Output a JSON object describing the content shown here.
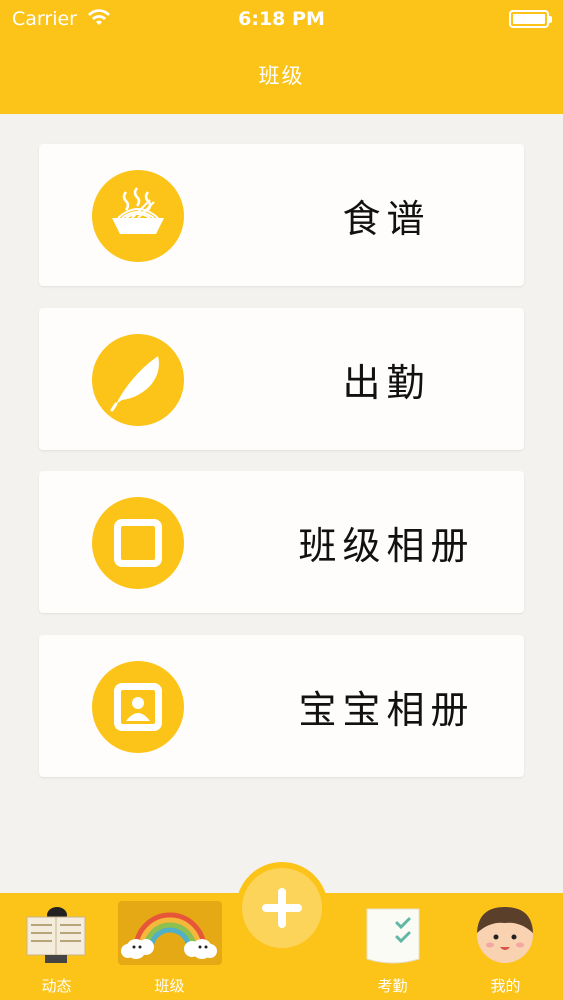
{
  "status_bar": {
    "carrier": "Carrier",
    "time": "6:18 PM"
  },
  "nav": {
    "title": "班级"
  },
  "menu": {
    "items": [
      {
        "label": "食谱",
        "icon": "noodle-bowl-icon"
      },
      {
        "label": "出勤",
        "icon": "feather-icon"
      },
      {
        "label": "班级相册",
        "icon": "photo-frame-icon"
      },
      {
        "label": "宝宝相册",
        "icon": "portrait-frame-icon"
      }
    ]
  },
  "tabbar": {
    "items": [
      {
        "label": "动态",
        "icon": "newspaper-reader-icon",
        "active": false
      },
      {
        "label": "班级",
        "icon": "rainbow-icon",
        "active": true
      },
      {
        "label": "考勤",
        "icon": "checklist-icon",
        "active": false
      },
      {
        "label": "我的",
        "icon": "boy-face-icon",
        "active": false
      }
    ],
    "add_button_icon": "plus-icon"
  },
  "colors": {
    "brand_yellow": "#fcc318",
    "background": "#f4f2ee",
    "card": "#fefdfb",
    "text": "#111111"
  }
}
